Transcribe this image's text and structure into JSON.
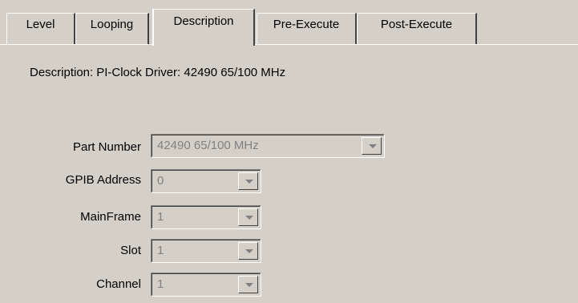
{
  "tabs": [
    {
      "label": "Level",
      "active": false
    },
    {
      "label": "Looping",
      "active": false
    },
    {
      "label": "Description",
      "active": true
    },
    {
      "label": "Pre-Execute",
      "active": false
    },
    {
      "label": "Post-Execute",
      "active": false
    }
  ],
  "description": {
    "label": "Description:",
    "value": "PI-Clock Driver: 42490 65/100 MHz"
  },
  "fields": {
    "part_number": {
      "label": "Part Number",
      "value": "42490 65/100 MHz"
    },
    "gpib_address": {
      "label": "GPIB Address",
      "value": "0"
    },
    "mainframe": {
      "label": "MainFrame",
      "value": "1"
    },
    "slot": {
      "label": "Slot",
      "value": "1"
    },
    "channel": {
      "label": "Channel",
      "value": "1"
    }
  },
  "icons": {
    "dropdown": "chevron-down-icon"
  }
}
